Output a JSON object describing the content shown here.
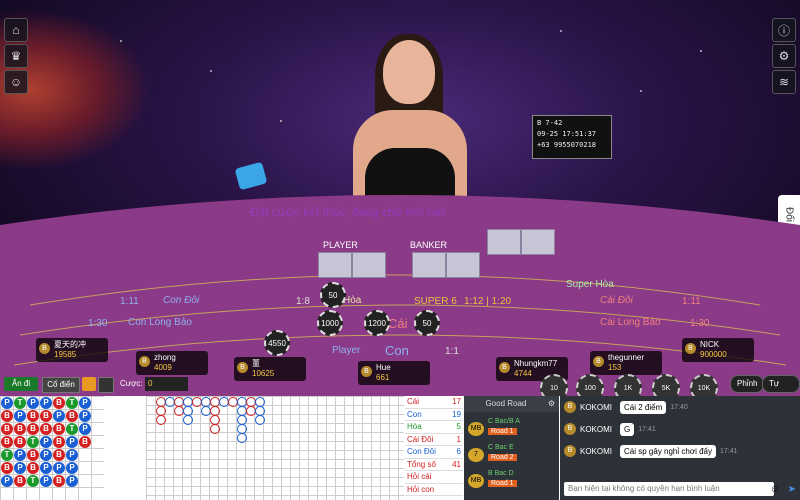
{
  "overlay": {
    "status_text": "Đặt cược kết thúc, đang chờ mở bài!"
  },
  "table_screen": {
    "line1": "B      7-42",
    "line2": "09-25  17:51:37",
    "line3": "+63 9955070218"
  },
  "side_tab": {
    "label": "Đổi trò chơi"
  },
  "table": {
    "player_label": "PLAYER",
    "banker_label": "BANKER",
    "con_doi": "Con Đôi",
    "con_doi_ratio": "1:11",
    "cai_doi": "Cái Đôi",
    "cai_doi_ratio": "1:11",
    "hoa": "Hòa",
    "hoa_ratio": "1:8",
    "super6": "SUPER 6",
    "super6_ratio": "1:12 | 1:20",
    "super_hoa": "Super Hòa",
    "con_long_bao": "Con Long Bảo",
    "con_long_bao_ratio": "1:30",
    "cai_long_bao": "Cái Long Bảo",
    "cai_long_bao_ratio": "1:30",
    "player_text": "Player",
    "con_text": "Con",
    "con_ratio": "1:1",
    "cai_text": "Cái",
    "chips_on_table": [
      "50",
      "1000",
      "1200",
      "50",
      "4550"
    ]
  },
  "players": [
    {
      "name": "夏天的冲",
      "amount": "19585"
    },
    {
      "name": "zhong",
      "amount": "4009"
    },
    {
      "name": "董",
      "amount": "10625"
    },
    {
      "name": "Hue",
      "amount": "661"
    },
    {
      "name": "Nhungkm77",
      "amount": "4744"
    },
    {
      "name": "thegunner",
      "amount": "153"
    },
    {
      "name": "NICK",
      "amount": "900000"
    }
  ],
  "betbar": {
    "hide_label": "Ẩn đi",
    "mode_label": "Cổ điển",
    "bet_label": "Cược:",
    "bet_value": "0",
    "chips": [
      "10",
      "100",
      "1K",
      "5K",
      "10K"
    ],
    "tip_label": "Phỉnh",
    "auto_label": "Tự động"
  },
  "stats": [
    {
      "label": "Cái",
      "value": "17",
      "color": "#d42020"
    },
    {
      "label": "Con",
      "value": "19",
      "color": "#1a5fd4"
    },
    {
      "label": "Hòa",
      "value": "5",
      "color": "#1a9a2a"
    },
    {
      "label": "Cái Đôi",
      "value": "1",
      "color": "#d42020"
    },
    {
      "label": "Con Đôi",
      "value": "6",
      "color": "#1a5fd4"
    },
    {
      "label": "Tổng số",
      "value": "41",
      "color": "#d42020"
    },
    {
      "label": "Hỏi cái",
      "value": "",
      "color": "#d42020"
    },
    {
      "label": "Hỏi con",
      "value": "",
      "color": "#d42020"
    }
  ],
  "goodroad": {
    "title": "Good Road",
    "tables": [
      {
        "code": "MB",
        "name": "C Bac/B A",
        "road": "Road 1"
      },
      {
        "code": "7",
        "name": "C Bac E",
        "road": "Road 2"
      },
      {
        "code": "MB",
        "name": "B Bac D",
        "road": "Road 1"
      }
    ]
  },
  "chat": {
    "messages": [
      {
        "user": "KOKOMI",
        "text": "Cái 2 điểm",
        "time": "17:40"
      },
      {
        "user": "KOKOMI",
        "text": "G",
        "time": "17:41"
      },
      {
        "user": "KOKOMI",
        "text": "Cái sp gây nghỉ chơi đấy",
        "time": "17:41"
      }
    ],
    "placeholder": "Bạn hiện tại không có quyền hạn bình luận"
  }
}
